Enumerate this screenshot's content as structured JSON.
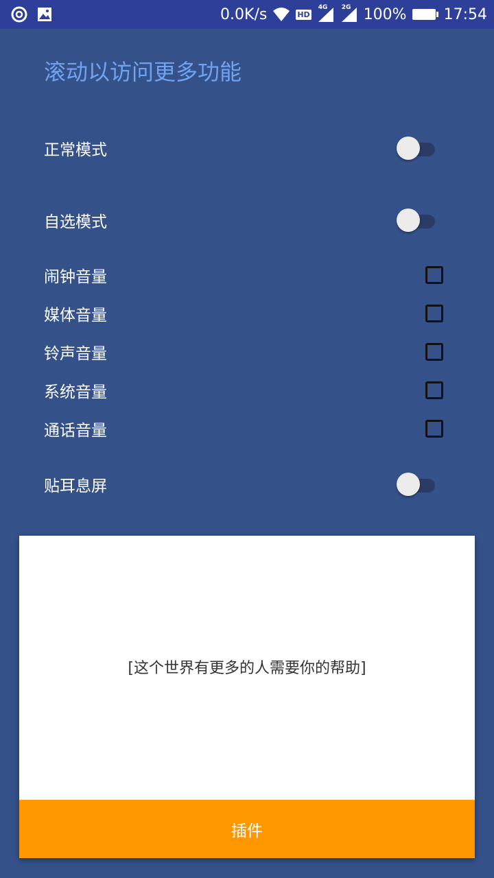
{
  "status_bar": {
    "net_speed": "0.0K/s",
    "hd": "HD",
    "net1": "4G",
    "net2": "2G",
    "battery": "100%",
    "time": "17:54"
  },
  "title": "滚动以访问更多功能",
  "modes": {
    "normal": {
      "label": "正常模式",
      "on": false
    },
    "custom": {
      "label": "自选模式",
      "on": false
    }
  },
  "volumes": [
    {
      "label": "闹钟音量",
      "checked": false
    },
    {
      "label": "媒体音量",
      "checked": false
    },
    {
      "label": "铃声音量",
      "checked": false
    },
    {
      "label": "系统音量",
      "checked": false
    },
    {
      "label": "通话音量",
      "checked": false
    }
  ],
  "proximity": {
    "label": "贴耳息屏",
    "on": false
  },
  "card": {
    "message": "[这个世界有更多的人需要你的帮助]",
    "button": "插件"
  }
}
